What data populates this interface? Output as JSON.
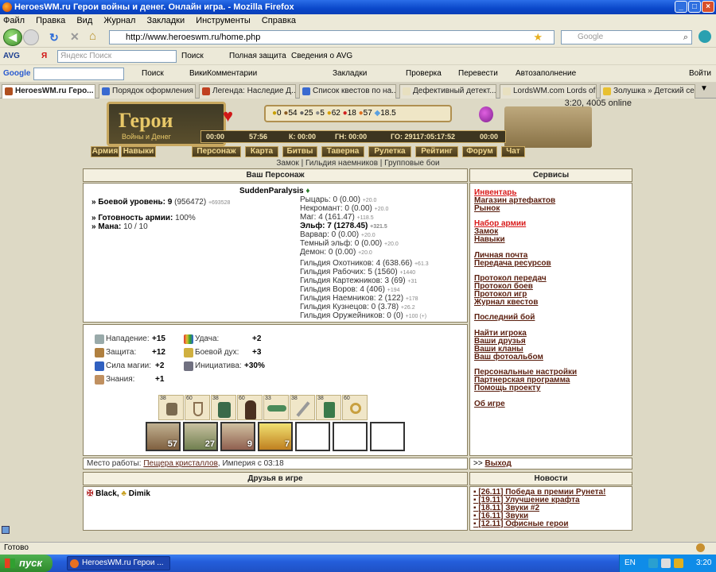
{
  "window": {
    "title": "HeroesWM.ru Герои войны и денег. Онлайн игра. - Mozilla Firefox"
  },
  "menu": [
    "Файл",
    "Правка",
    "Вид",
    "Журнал",
    "Закладки",
    "Инструменты",
    "Справка"
  ],
  "nav": {
    "url": "http://www.heroeswm.ru/home.php",
    "search_placeholder": "Google"
  },
  "toolbar1": {
    "avg": "AVG",
    "search_placeholder": "Яндекс Поиск",
    "search_btn": "Поиск",
    "protection": "Полная защита",
    "avg_info": "Сведения о AVG"
  },
  "toolbar2": {
    "google": "Google",
    "search": "Поиск",
    "wiki": "ВикиКомментарии",
    "bookmarks": "Закладки",
    "check": "Проверка",
    "translate": "Перевести",
    "autofill": "Автозаполнение",
    "login": "Войти"
  },
  "tabs": [
    "HeroesWM.ru Геро...",
    "Порядок оформления ...",
    "Легенда: Наследие Д...",
    "Список квестов по на...",
    "Дефективный детект...",
    "LordsWM.com Lords of ...",
    "Золушка » Детский се..."
  ],
  "header": {
    "logo": "Герои",
    "logo_sub": "Войны и Денег",
    "online": "3:20, 4005 online",
    "resources": [
      "0",
      "54",
      "25",
      "5",
      "62",
      "18",
      "57",
      "18.5"
    ],
    "timers": [
      "00:00",
      "57:56",
      "К: 00:00",
      "ГН: 00:00",
      "ГО: 29117:05:17:52",
      "00:00"
    ],
    "left_btns": [
      "Армия",
      "Навыки"
    ],
    "nav": [
      "Персонаж",
      "Карта",
      "Битвы",
      "Таверна",
      "Рулетка",
      "Рейтинг",
      "Форум",
      "Чат"
    ],
    "subnav": "Замок | Гильдия наемников | Групповые бои"
  },
  "character": {
    "head": "Ваш Персонаж",
    "name": "SuddenParalysis",
    "level_label": "» Боевой уровень:",
    "level": "9",
    "level_exp": "(956472)",
    "level_next": "+693528",
    "ready_label": "» Готовность армии:",
    "ready": "100%",
    "mana_label": "» Мана:",
    "mana": "10 / 10",
    "factions": [
      {
        "label": "Рыцарь: 0 (0.00)",
        "plus": "+20.0"
      },
      {
        "label": "Некромант: 0 (0.00)",
        "plus": "+20.0"
      },
      {
        "label": "Маг: 4 (161.47)",
        "plus": "+118.5"
      },
      {
        "label": "Эльф: 7 (1278.45)",
        "plus": "+321.5"
      },
      {
        "label": "Варвар: 0 (0.00)",
        "plus": "+20.0"
      },
      {
        "label": "Темный эльф: 0 (0.00)",
        "plus": "+20.0"
      },
      {
        "label": "Демон: 0 (0.00)",
        "plus": "+20.0"
      }
    ],
    "guilds": [
      {
        "label": "Гильдия Охотников: 4 (638.66)",
        "plus": "+61.3"
      },
      {
        "label": "Гильдия Рабочих: 5 (1560)",
        "plus": "+1440"
      },
      {
        "label": "Гильдия Картежников: 3 (69)",
        "plus": "+31"
      },
      {
        "label": "Гильдия Воров: 4 (406)",
        "plus": "+194"
      },
      {
        "label": "Гильдия Наемников: 2 (122)",
        "plus": "+178"
      },
      {
        "label": "Гильдия Кузнецов: 0 (3.78)",
        "plus": "+26.2"
      },
      {
        "label": "Гильдия Оружейников: 0 (0)",
        "plus": "+100 (+)"
      }
    ]
  },
  "stats": {
    "attack_l": "Нападение:",
    "attack": "+15",
    "defense_l": "Защита:",
    "defense": "+12",
    "magic_l": "Сила магии:",
    "magic": "+2",
    "knowledge_l": "Знания:",
    "knowledge": "+1",
    "luck_l": "Удача:",
    "luck": "+2",
    "morale_l": "Боевой дух:",
    "morale": "+3",
    "init_l": "Инициатива:",
    "init": "+30%"
  },
  "equipment": [
    "38",
    "60",
    "38",
    "60",
    "33",
    "38",
    "38",
    "60"
  ],
  "army": [
    "57",
    "27",
    "9",
    "7",
    "",
    "",
    ""
  ],
  "work": {
    "label": "Место работы:",
    "place": "Пещера кристаллов",
    "rest": ", Империя с 03:18"
  },
  "friends": {
    "head": "Друзья в игре",
    "list": [
      "Black",
      ", ",
      "Dimik"
    ]
  },
  "services": {
    "head": "Сервисы",
    "items": [
      "Инвентарь",
      "Магазин артефактов",
      "Рынок",
      "Набор армии",
      "Замок",
      "Навыки",
      "Личная почта",
      "Передача ресурсов",
      "Протокол передач",
      "Протокол боев",
      "Протокол игр",
      "Журнал квестов",
      "Последний бой",
      "Найти игрока",
      "Ваши друзья",
      "Ваши кланы",
      "Ваш фотоальбом",
      "Персональные настройки",
      "Партнерская программа",
      "Помощь проекту",
      "Об игре"
    ]
  },
  "exit": {
    "prefix": ">>",
    "label": "Выход"
  },
  "news": {
    "head": "Новости",
    "items": [
      "[26.11] Победа в премии Рунета!",
      "[19.11] Улучшение крафта",
      "[18.11] Звуки #2",
      "[16.11] Звуки",
      "[12.11] Офисные герои"
    ]
  },
  "status": "Готово",
  "taskbar": {
    "start": "пуск",
    "task": "HeroesWM.ru Герои ...",
    "lang": "EN",
    "time": "3:20"
  },
  "colors": {
    "titlebar": "#0a47c9",
    "link": "#5b1f0f",
    "highlight": "#d81818",
    "page_bg": "#ddd9c5"
  }
}
